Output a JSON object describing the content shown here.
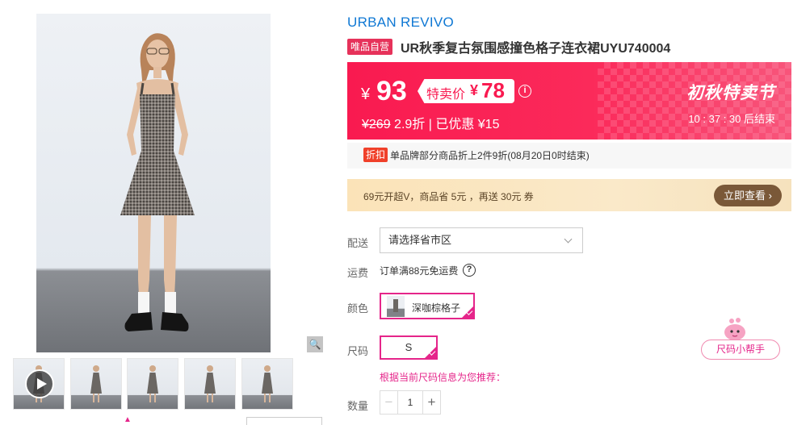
{
  "product": {
    "brand": "URBAN REVIVO",
    "self_tag": "唯品自营",
    "title": "UR秋季复古氛围感撞色格子连衣裙UYU740004"
  },
  "price": {
    "yen": "¥",
    "current": "93",
    "special_label": "特卖价",
    "special_yen": "¥",
    "special_price": "78",
    "info_icon": "i",
    "original_strike": "¥269",
    "discount_info": " 2.9折 | 已优惠 ¥15",
    "festival": "初秋特卖节",
    "countdown": "10 : 37 : 30  后结束",
    "colors": {
      "banner": "#f91a50",
      "accent": "#e5258a"
    }
  },
  "promo": {
    "tag": "折扣",
    "text": "单品牌部分商品折上2件9折(08月20日0时结束)"
  },
  "svip": {
    "text": "69元开超V，商品省 5元 ，再送 30元 券",
    "button": "立即查看",
    "chevron": "›"
  },
  "options": {
    "delivery_label": "配送",
    "delivery_value": "请选择省市区",
    "shipping_label": "运费",
    "shipping_value": "订单满88元免运费",
    "help_icon": "?",
    "color_label": "颜色",
    "color_value": "深咖棕格子",
    "size_label": "尺码",
    "size_value": "S",
    "size_recommend": "根据当前尺码信息为您推荐：",
    "qty_label": "数量",
    "qty_minus": "−",
    "qty_value": "1",
    "qty_plus": "+"
  },
  "helper": {
    "label": "尺码小帮手"
  },
  "gallery": {
    "zoom_icon": "🔍"
  },
  "icons": [
    "search-icon",
    "play-icon",
    "info-icon",
    "help-icon",
    "chevron-down-icon",
    "chevron-right-icon",
    "check-icon"
  ]
}
